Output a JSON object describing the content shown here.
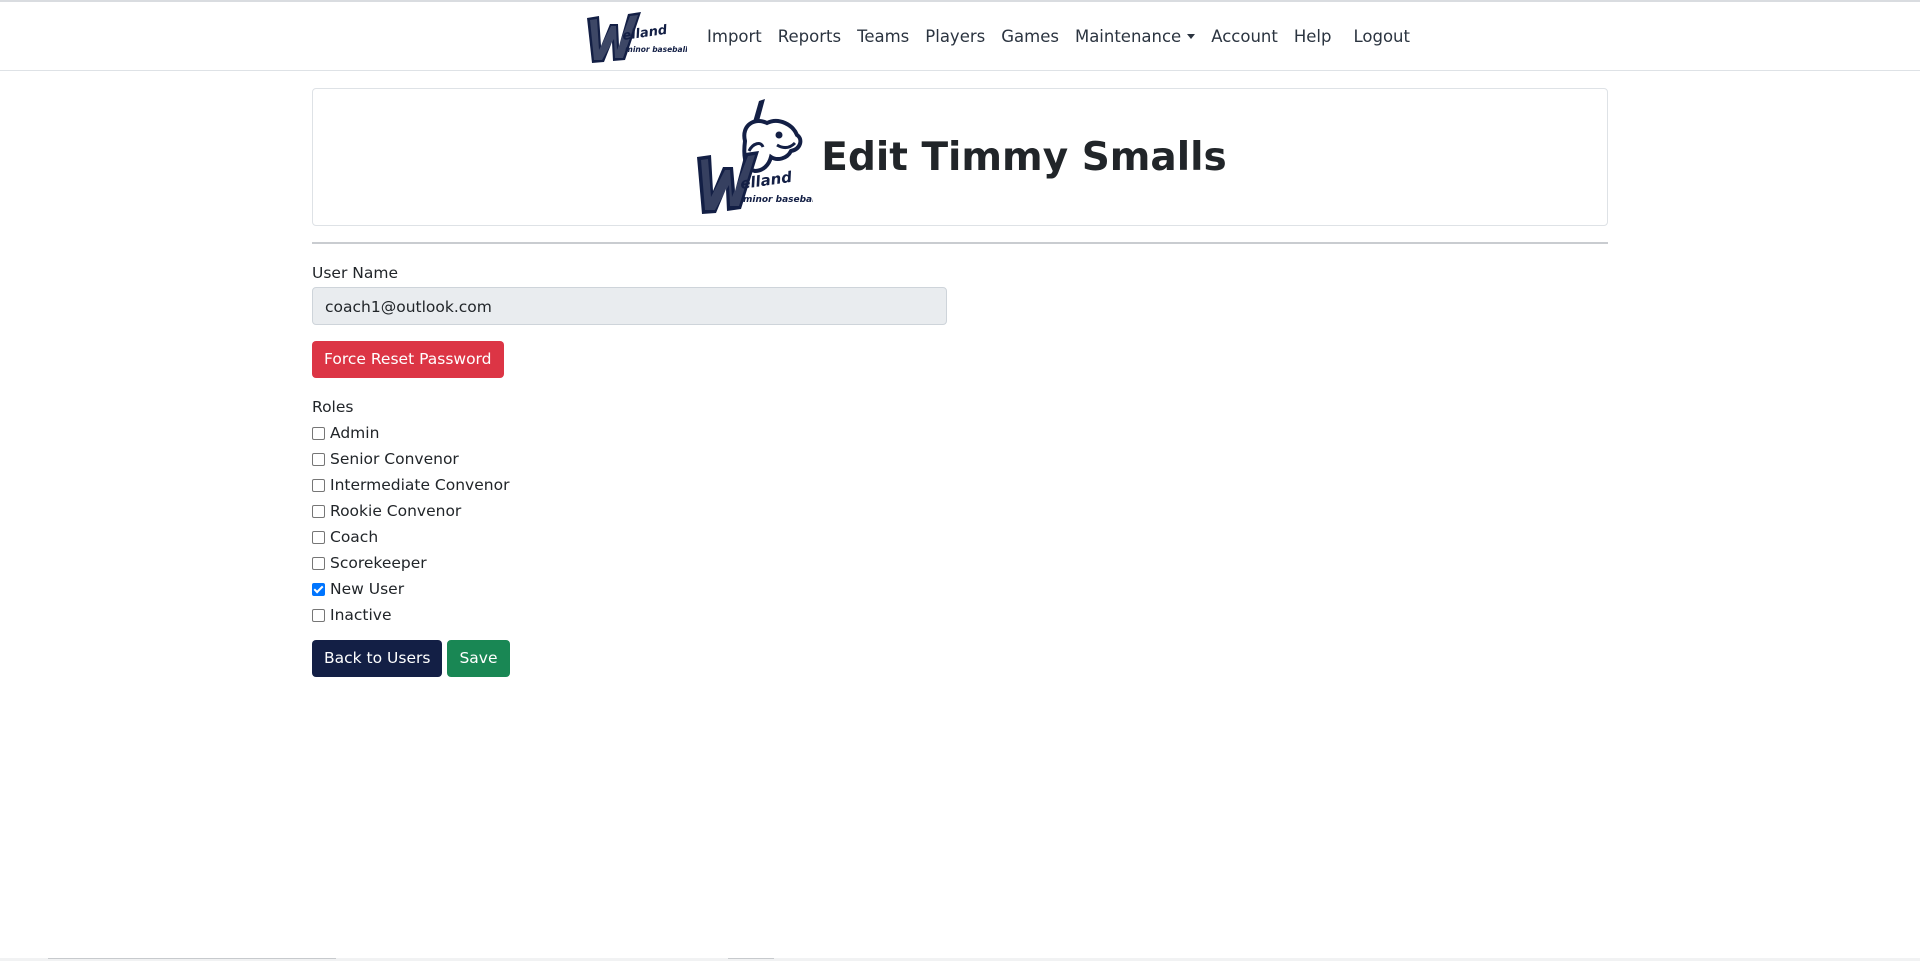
{
  "nav": {
    "brand_logo_text": "Welland minor baseball",
    "links": {
      "import": "Import",
      "reports": "Reports",
      "teams": "Teams",
      "players": "Players",
      "games": "Games",
      "maintenance": "Maintenance",
      "account": "Account",
      "help": "Help",
      "logout": "Logout"
    }
  },
  "header": {
    "title": "Edit Timmy Smalls",
    "logo_text": "Welland minor baseball"
  },
  "form": {
    "username_label": "User Name",
    "username_value": "coach1@outlook.com",
    "force_reset_label": "Force Reset Password",
    "roles_label": "Roles",
    "roles": [
      {
        "label": "Admin",
        "checked": false
      },
      {
        "label": "Senior Convenor",
        "checked": false
      },
      {
        "label": "Intermediate Convenor",
        "checked": false
      },
      {
        "label": "Rookie Convenor",
        "checked": false
      },
      {
        "label": "Coach",
        "checked": false
      },
      {
        "label": "Scorekeeper",
        "checked": false
      },
      {
        "label": "New User",
        "checked": true
      },
      {
        "label": "Inactive",
        "checked": false
      }
    ],
    "back_label": "Back to Users",
    "save_label": "Save"
  },
  "colors": {
    "brand_navy": "#131f45",
    "danger": "#dc3545",
    "success": "#198754",
    "checkbox_checked": "#0075ff"
  }
}
